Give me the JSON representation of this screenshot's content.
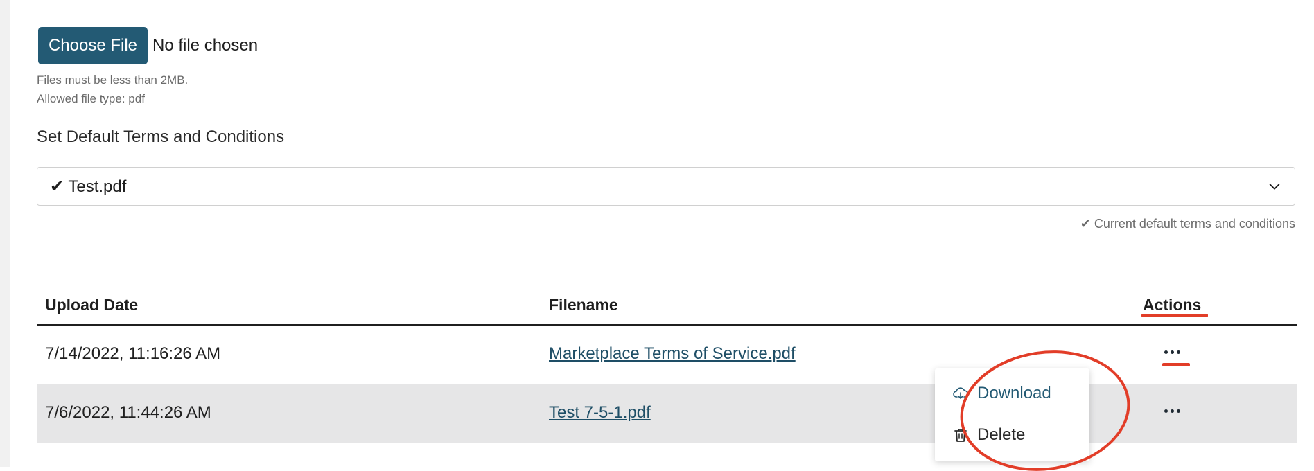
{
  "upload": {
    "button_label": "Choose File",
    "status": "No file chosen",
    "size_hint": "Files must be less than 2MB.",
    "type_hint": "Allowed file type: pdf"
  },
  "default_terms": {
    "label": "Set Default Terms and Conditions",
    "selected_value": "✔ Test.pdf",
    "note": "✔ Current default terms and conditions"
  },
  "table": {
    "headers": {
      "upload_date": "Upload Date",
      "filename": "Filename",
      "actions": "Actions"
    },
    "rows": [
      {
        "upload_date": "7/14/2022, 11:16:26 AM",
        "filename": "Marketplace Terms of Service.pdf"
      },
      {
        "upload_date": "7/6/2022, 11:44:26 AM",
        "filename": "Test 7-5-1.pdf"
      }
    ]
  },
  "actions_menu": {
    "items": [
      {
        "label": "Download",
        "icon": "cloud-download-icon"
      },
      {
        "label": "Delete",
        "icon": "trash-icon"
      }
    ]
  },
  "colors": {
    "primary": "#235a74",
    "link": "#1e4e66",
    "annotation": "#e23d28",
    "row_alt": "#e6e6e7"
  }
}
